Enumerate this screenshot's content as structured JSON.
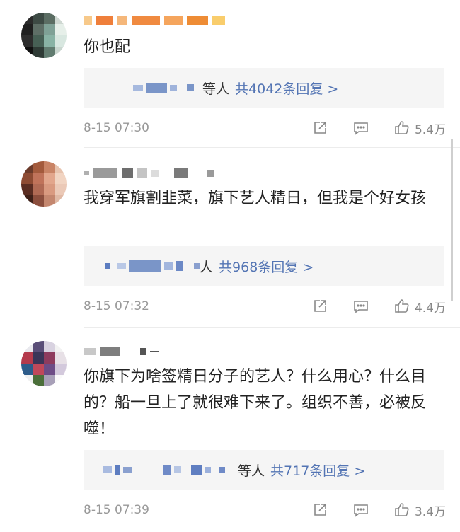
{
  "comments": [
    {
      "text": "你也配",
      "reply": {
        "deng": "等人",
        "total": "共4042条回复 >"
      },
      "time": "8-15 07:30",
      "likes": "5.4万"
    },
    {
      "text": "我穿军旗割韭菜，旗下艺人精日，但我是个好女孩",
      "reply": {
        "deng": "人",
        "total": "共968条回复 >"
      },
      "time": "8-15 07:32",
      "likes": "4.4万"
    },
    {
      "text": "你旗下为啥签精日分子的艺人？什么用心？什么目的？船一旦上了就很难下来了。组织不善，必被反噬！",
      "reply": {
        "deng": "等人",
        "total": "共717条回复 >"
      },
      "time": "8-15 07:39",
      "likes": "3.4万"
    }
  ],
  "icons": {
    "share": "share-icon",
    "reply": "comment-icon",
    "like": "thumbs-up-icon"
  },
  "colors": {
    "link": "#5475b4",
    "meta": "#999999",
    "reply_bg": "#f5f5f5"
  }
}
